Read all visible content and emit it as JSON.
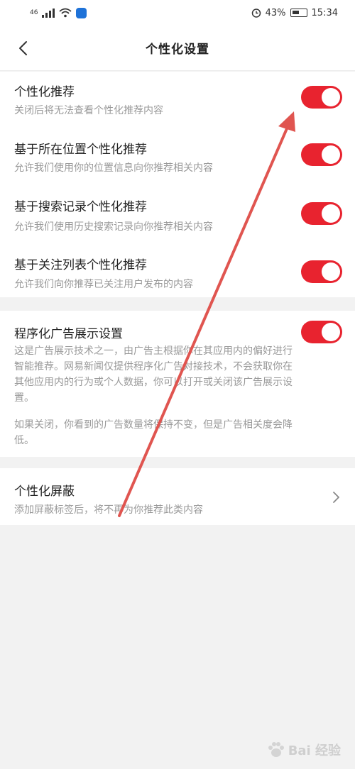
{
  "status_bar": {
    "signal": "46",
    "battery": "43%",
    "time": "15:34"
  },
  "header": {
    "title": "个性化设置",
    "back_icon": "chevron-left-icon"
  },
  "settings": [
    {
      "title": "个性化推荐",
      "desc": "关闭后将无法查看个性化推荐内容",
      "enabled": true
    },
    {
      "title": "基于所在位置个性化推荐",
      "desc": "允许我们使用你的位置信息向你推荐相关内容",
      "enabled": true
    },
    {
      "title": "基于搜索记录个性化推荐",
      "desc": "允许我们使用历史搜索记录向你推荐相关内容",
      "enabled": true
    },
    {
      "title": "基于关注列表个性化推荐",
      "desc": "允许我们向你推荐已关注用户发布的内容",
      "enabled": true
    }
  ],
  "ad_setting": {
    "title": "程序化广告展示设置",
    "desc_1": "这是广告展示技术之一，由广告主根据你在其应用内的偏好进行智能推荐。网易新闻仅提供程序化广告对接技术，不会获取你在其他应用内的行为或个人数据，你可以打开或关闭该广告展示设置。",
    "desc_2": "如果关闭，你看到的广告数量将保持不变，但是广告相关度会降低。",
    "enabled": true
  },
  "block_setting": {
    "title": "个性化屏蔽",
    "desc": "添加屏蔽标签后，将不再为你推荐此类内容",
    "icon": "chevron-right-icon"
  },
  "watermark": {
    "text": "Bai 经验"
  },
  "colors": {
    "toggle_on": "#e8232f",
    "annotation_arrow": "#e05550"
  }
}
